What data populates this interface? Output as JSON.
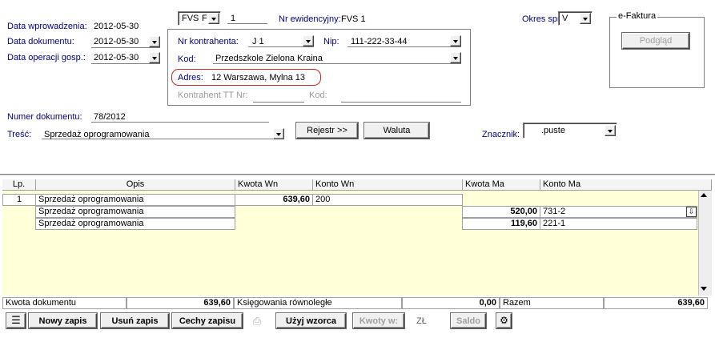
{
  "header": {
    "data_wprowadzenia_label": "Data wprowadzenia:",
    "data_wprowadzenia": "2012-05-30",
    "data_dokumentu_label": "Data dokumentu:",
    "data_dokumentu": "2012-05-30",
    "data_operacji_label": "Data operacji gosp.:",
    "data_operacji": "2012-05-30",
    "typ_dokumentu": "FVS",
    "typ_suffix": "F",
    "numer": "1",
    "nr_ewidencyjny_label": "Nr ewidencyjny:",
    "nr_ewidencyjny": "FVS  1",
    "okres_label": "Okres spr.",
    "okres_value": "V",
    "numer_dokumentu_label": "Numer dokumentu:",
    "numer_dokumentu": "78/2012",
    "tresc_label": "Treść:",
    "tresc_value": "Sprzedaż oprogramowania",
    "rejestr_button": "Rejestr >>",
    "waluta_button": "Waluta",
    "znacznik_label": "Znacznik:",
    "znacznik_value": ".puste"
  },
  "kontrahent": {
    "nr_label": "Nr kontrahenta:",
    "nr_value": "J 1",
    "nip_label": "Nip:",
    "nip_value": "111-222-33-44",
    "kod_label": "Kod:",
    "kod_value": "Przedszkole Zielona Kraina",
    "adres_label": "Adres:",
    "adres_value": "12 Warszawa, Mylna 13",
    "tt_label": "Kontrahent TT Nr:",
    "tt_kod_label": "Kod:"
  },
  "efaktura": {
    "title": "e-Faktura",
    "podglad_button": "Podgląd"
  },
  "table": {
    "columns": [
      "Lp.",
      "Opis",
      "Kwota Wn",
      "Konto Wn",
      "Kwota Ma",
      "Konto Ma"
    ],
    "rows": [
      {
        "lp": "1",
        "opis": "Sprzedaż oprogramowania",
        "kwota_wn": "639,60",
        "konto_wn": "200",
        "kwota_ma": "",
        "konto_ma": ""
      },
      {
        "lp": "",
        "opis": "Sprzedaż oprogramowania",
        "kwota_wn": "",
        "konto_wn": "",
        "kwota_ma": "520,00",
        "konto_ma": "731-2"
      },
      {
        "lp": "",
        "opis": "Sprzedaż oprogramowania",
        "kwota_wn": "",
        "konto_wn": "",
        "kwota_ma": "119,60",
        "konto_ma": "221-1"
      }
    ]
  },
  "totals": {
    "kwota_dokumentu_label": "Kwota dokumentu",
    "kwota_dokumentu": "639,60",
    "ksiegowania_label": "Księgowania równoległe",
    "ksiegowania_value": "0,00",
    "razem_label": "Razem",
    "razem_value": "639,60"
  },
  "toolbar": {
    "nowy_zapis": "Nowy zapis",
    "usun_zapis": "Usuń zapis",
    "cechy_zapisu": "Cechy zapisu",
    "uzyj_wzorca": "Użyj wzorca",
    "kwoty_w": "Kwoty w:",
    "currency": "ZŁ",
    "saldo": "Saldo"
  },
  "colors": {
    "label_blue": "#000080",
    "grid_yellow": "#ffffd8",
    "adres_highlight": "#d02020"
  }
}
